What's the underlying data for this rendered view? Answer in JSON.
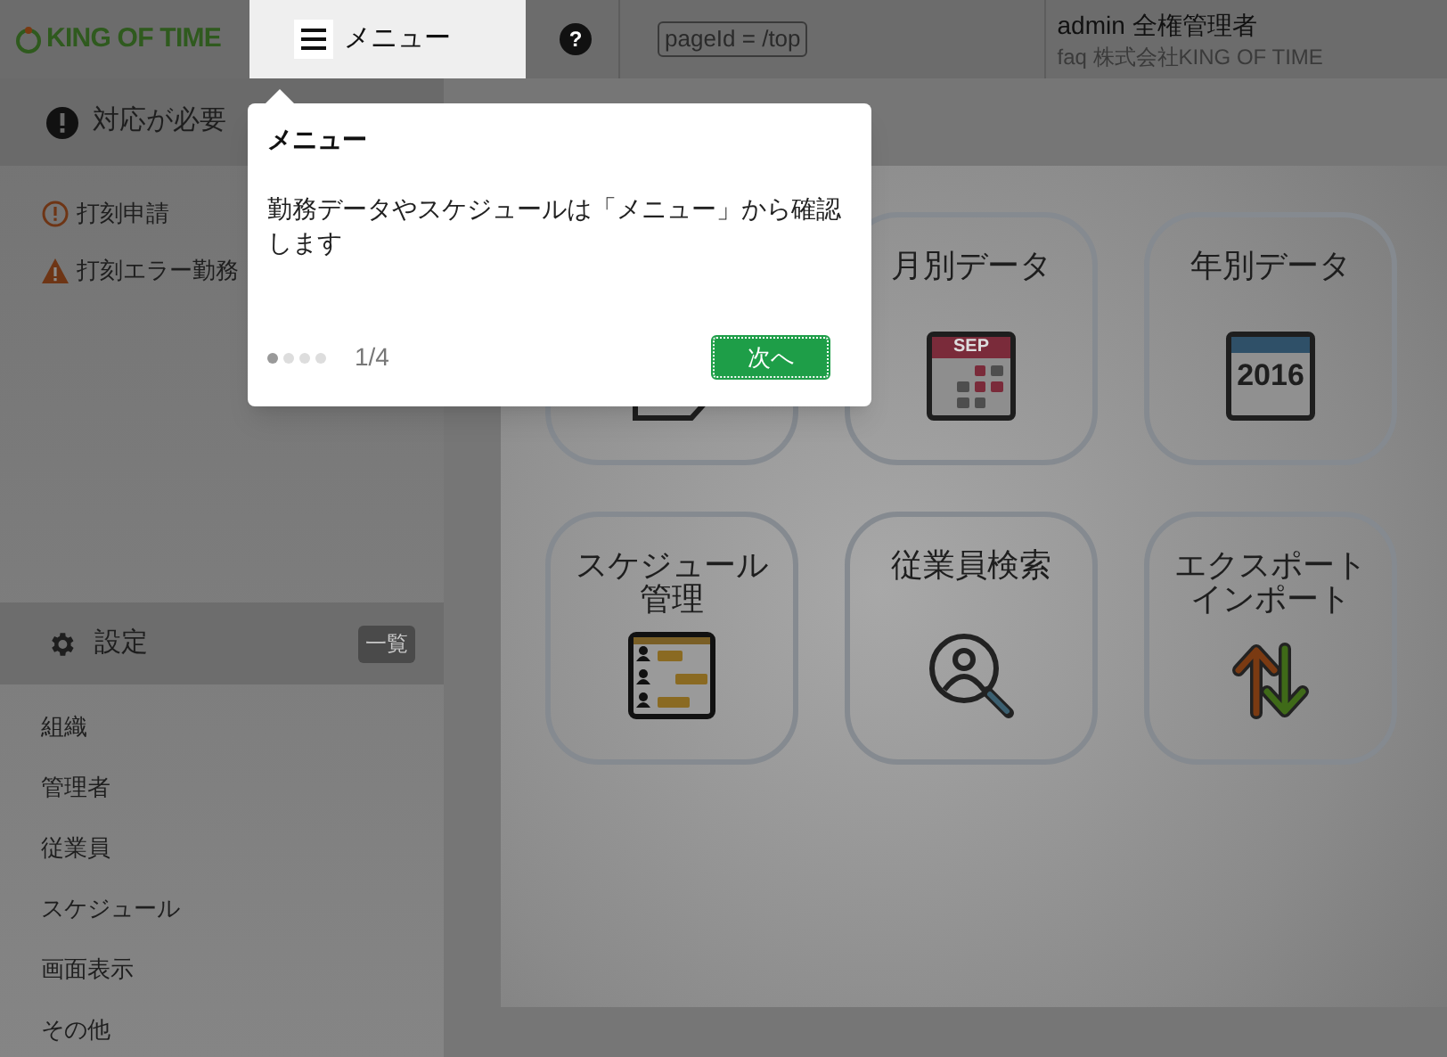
{
  "header": {
    "logo": "KING OF TIME",
    "menu_button": {
      "label": "メニュー",
      "highlighted": true
    },
    "help": "?",
    "page_id": "pageId = /top",
    "user": {
      "name": "admin 全権管理者",
      "company": "faq 株式会社KING OF TIME"
    }
  },
  "alert_bar": {
    "label": "対応が必要"
  },
  "sidebar": {
    "alerts": [
      {
        "kind": "info",
        "label": "打刻申請"
      },
      {
        "kind": "warning",
        "label": "打刻エラー勤務"
      }
    ],
    "settings": {
      "title": "設定",
      "badge": "一覧",
      "items": [
        "組織",
        "管理者",
        "従業員",
        "スケジュール",
        "画面表示",
        "その他"
      ]
    }
  },
  "tiles": [
    {
      "kind": "document"
    },
    {
      "kind": "month",
      "lines": [
        "月別データ"
      ],
      "icon_text": "SEP"
    },
    {
      "kind": "year",
      "lines": [
        "年別データ"
      ],
      "icon_text": "2016"
    },
    {
      "kind": "schedule",
      "lines": [
        "スケジュール",
        "管理"
      ]
    },
    {
      "kind": "search",
      "lines": [
        "従業員検索"
      ]
    },
    {
      "kind": "transfer",
      "lines": [
        "エクスポート",
        "インポート"
      ]
    }
  ],
  "tour": {
    "title": "メニュー",
    "body": "勤務データやスケジュールは「メニュー」から確認します",
    "steps": [
      {
        "selected": true
      },
      {
        "selected": false
      },
      {
        "selected": false
      },
      {
        "selected": false
      }
    ],
    "counter": "1/4",
    "next": "次へ"
  }
}
